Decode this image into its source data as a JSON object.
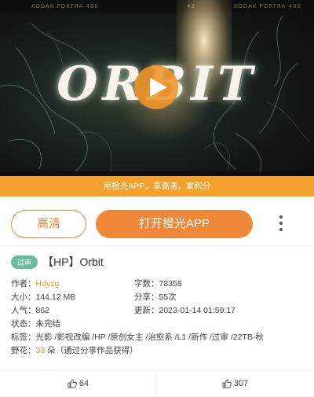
{
  "video": {
    "film_text_left": "KODAK PORTRA 400",
    "film_text_mid": "43",
    "film_text_right": "KODAK PORTRA 400",
    "title_art": "ORBIT",
    "play_icon": "play-icon"
  },
  "banner": {
    "text": "用橙光APP，享高清，拿积分"
  },
  "actions": {
    "hd_label": "高清",
    "open_app_label": "打开橙光APP",
    "more_icon": "more-vertical-icon"
  },
  "work": {
    "status_badge": "过审",
    "title": "【HP】Orbit",
    "author_label": "作者：",
    "author": "Hdyzg",
    "word_count_label": "字数：",
    "word_count": "78358",
    "size_label": "大小：",
    "size": "144.12 MB",
    "shares_label": "分享：",
    "shares": "55次",
    "popularity_label": "人气：",
    "popularity": "862",
    "updated_label": "更新：",
    "updated": "2023-01-14 01:59:17",
    "state_label": "状态：",
    "state": "未完结",
    "tags_label": "标签：",
    "tags": "光影 /影视改编 /HP /原创女主 /治愈系 /L1 /新作 /过审 /22TB-秋",
    "flowers_label": "野花：",
    "flowers_count": "33",
    "flowers_suffix": " 朵（通过分享作品获得）"
  },
  "stats": {
    "left_count": "64",
    "right_count": "307",
    "icon": "thumbs-up-icon"
  },
  "colors": {
    "accent": "#f0883a",
    "banner": "#f4a02c",
    "badge": "#6bbba0"
  }
}
